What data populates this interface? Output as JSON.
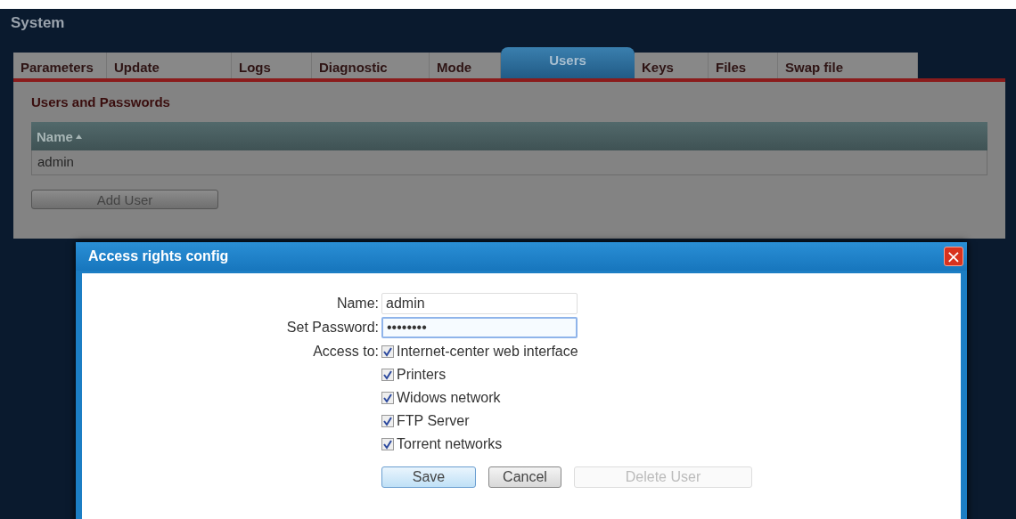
{
  "header": {
    "title": "System"
  },
  "tabs": [
    {
      "label": "Parameters",
      "selected": false
    },
    {
      "label": "Update",
      "selected": false
    },
    {
      "label": "Logs",
      "selected": false
    },
    {
      "label": "Diagnostic",
      "selected": false
    },
    {
      "label": "Mode",
      "selected": false
    },
    {
      "label": "Users",
      "selected": true
    },
    {
      "label": "Keys",
      "selected": false
    },
    {
      "label": "Files",
      "selected": false
    },
    {
      "label": "Swap file",
      "selected": false
    }
  ],
  "panel": {
    "title": "Users and Passwords",
    "table": {
      "columns": [
        {
          "label": "Name",
          "sorted_ascending": true
        }
      ],
      "rows": [
        [
          "admin"
        ]
      ]
    },
    "add_button": "Add User"
  },
  "dialog": {
    "title": "Access rights config",
    "close": "×",
    "fields": [
      {
        "label": "Name:",
        "value": "admin",
        "focused": false
      },
      {
        "label": "Set Password:",
        "value": "••••••••",
        "focused": true
      }
    ],
    "access_label": "Access to:",
    "access": [
      {
        "label": "Internet-center web interface",
        "checked": true
      },
      {
        "label": "Printers",
        "checked": true
      },
      {
        "label": "Widows network",
        "checked": true
      },
      {
        "label": "FTP Server",
        "checked": true
      },
      {
        "label": "Torrent networks",
        "checked": true
      }
    ],
    "buttons": [
      {
        "label": "Save",
        "kind": "primary",
        "disabled": false
      },
      {
        "label": "Cancel",
        "kind": "normal",
        "disabled": false
      },
      {
        "label": "Delete User",
        "kind": "wide",
        "disabled": true
      }
    ]
  }
}
